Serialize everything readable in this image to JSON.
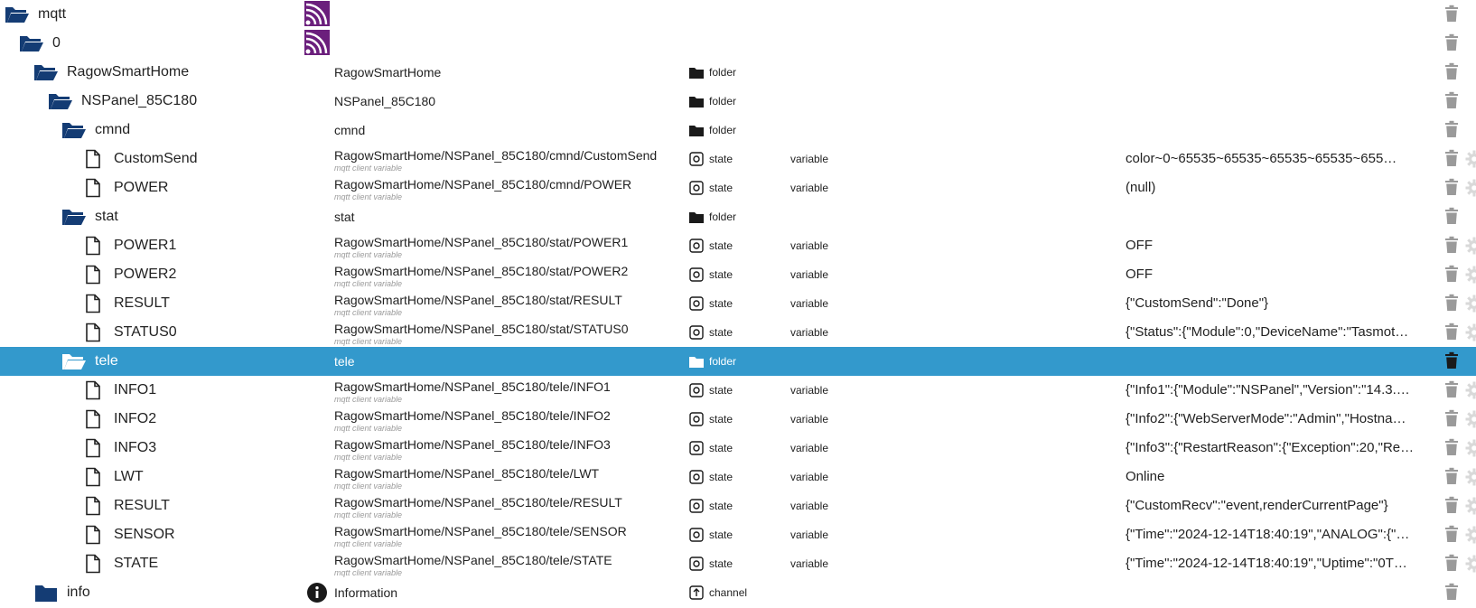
{
  "colors": {
    "folder": "#143c74",
    "selected": "#3399cc",
    "trash": "#9a9a9a",
    "adapter": "#6b1f7c"
  },
  "rows": [
    {
      "name": "mqtt",
      "icon": "folder-open",
      "depth": 0,
      "adapter": true,
      "label": "",
      "sublabel": "",
      "type": "",
      "role": "",
      "value": "",
      "gear": false
    },
    {
      "name": "0",
      "icon": "folder-open",
      "depth": 1,
      "adapter": true,
      "label": "",
      "sublabel": "",
      "type": "",
      "role": "",
      "value": "",
      "gear": false
    },
    {
      "name": "RagowSmartHome",
      "icon": "folder-open",
      "depth": 2,
      "label": "RagowSmartHome",
      "sublabel": "",
      "type": "folder",
      "role": "",
      "value": "",
      "gear": false
    },
    {
      "name": "NSPanel_85C180",
      "icon": "folder-open",
      "depth": 3,
      "label": "NSPanel_85C180",
      "sublabel": "",
      "type": "folder",
      "role": "",
      "value": "",
      "gear": false
    },
    {
      "name": "cmnd",
      "icon": "folder-open",
      "depth": 4,
      "label": "cmnd",
      "sublabel": "",
      "type": "folder",
      "role": "",
      "value": "",
      "gear": false
    },
    {
      "name": "CustomSend",
      "icon": "file",
      "depth": 5,
      "label": "RagowSmartHome/NSPanel_85C180/cmnd/CustomSend",
      "sublabel": "mqtt client variable",
      "type": "state",
      "role": "variable",
      "value": "color~0~65535~65535~65535~65535~655…",
      "gear": true
    },
    {
      "name": "POWER",
      "icon": "file",
      "depth": 5,
      "label": "RagowSmartHome/NSPanel_85C180/cmnd/POWER",
      "sublabel": "mqtt client variable",
      "type": "state",
      "role": "variable",
      "value": "(null)",
      "gear": true
    },
    {
      "name": "stat",
      "icon": "folder-open",
      "depth": 4,
      "label": "stat",
      "sublabel": "",
      "type": "folder",
      "role": "",
      "value": "",
      "gear": false
    },
    {
      "name": "POWER1",
      "icon": "file",
      "depth": 5,
      "label": "RagowSmartHome/NSPanel_85C180/stat/POWER1",
      "sublabel": "mqtt client variable",
      "type": "state",
      "role": "variable",
      "value": "OFF",
      "gear": true
    },
    {
      "name": "POWER2",
      "icon": "file",
      "depth": 5,
      "label": "RagowSmartHome/NSPanel_85C180/stat/POWER2",
      "sublabel": "mqtt client variable",
      "type": "state",
      "role": "variable",
      "value": "OFF",
      "gear": true
    },
    {
      "name": "RESULT",
      "icon": "file",
      "depth": 5,
      "label": "RagowSmartHome/NSPanel_85C180/stat/RESULT",
      "sublabel": "mqtt client variable",
      "type": "state",
      "role": "variable",
      "value": "{\"CustomSend\":\"Done\"}",
      "gear": true
    },
    {
      "name": "STATUS0",
      "icon": "file",
      "depth": 5,
      "label": "RagowSmartHome/NSPanel_85C180/stat/STATUS0",
      "sublabel": "mqtt client variable",
      "type": "state",
      "role": "variable",
      "value": "{\"Status\":{\"Module\":0,\"DeviceName\":\"Tasmot…",
      "gear": true
    },
    {
      "name": "tele",
      "icon": "folder-open",
      "depth": 4,
      "selected": true,
      "label": "tele",
      "sublabel": "",
      "type": "folder",
      "role": "",
      "value": "",
      "gear": false
    },
    {
      "name": "INFO1",
      "icon": "file",
      "depth": 5,
      "label": "RagowSmartHome/NSPanel_85C180/tele/INFO1",
      "sublabel": "mqtt client variable",
      "type": "state",
      "role": "variable",
      "value": "{\"Info1\":{\"Module\":\"NSPanel\",\"Version\":\"14.3.…",
      "gear": true
    },
    {
      "name": "INFO2",
      "icon": "file",
      "depth": 5,
      "label": "RagowSmartHome/NSPanel_85C180/tele/INFO2",
      "sublabel": "mqtt client variable",
      "type": "state",
      "role": "variable",
      "value": "{\"Info2\":{\"WebServerMode\":\"Admin\",\"Hostna…",
      "gear": true
    },
    {
      "name": "INFO3",
      "icon": "file",
      "depth": 5,
      "label": "RagowSmartHome/NSPanel_85C180/tele/INFO3",
      "sublabel": "mqtt client variable",
      "type": "state",
      "role": "variable",
      "value": "{\"Info3\":{\"RestartReason\":{\"Exception\":20,\"Re…",
      "gear": true
    },
    {
      "name": "LWT",
      "icon": "file",
      "depth": 5,
      "label": "RagowSmartHome/NSPanel_85C180/tele/LWT",
      "sublabel": "mqtt client variable",
      "type": "state",
      "role": "variable",
      "value": "Online",
      "gear": true
    },
    {
      "name": "RESULT",
      "icon": "file",
      "depth": 5,
      "label": "RagowSmartHome/NSPanel_85C180/tele/RESULT",
      "sublabel": "mqtt client variable",
      "type": "state",
      "role": "variable",
      "value": "{\"CustomRecv\":\"event,renderCurrentPage\"}",
      "gear": true
    },
    {
      "name": "SENSOR",
      "icon": "file",
      "depth": 5,
      "label": "RagowSmartHome/NSPanel_85C180/tele/SENSOR",
      "sublabel": "mqtt client variable",
      "type": "state",
      "role": "variable",
      "value": "{\"Time\":\"2024-12-14T18:40:19\",\"ANALOG\":{\"…",
      "gear": true
    },
    {
      "name": "STATE",
      "icon": "file",
      "depth": 5,
      "label": "RagowSmartHome/NSPanel_85C180/tele/STATE",
      "sublabel": "mqtt client variable",
      "type": "state",
      "role": "variable",
      "value": "{\"Time\":\"2024-12-14T18:40:19\",\"Uptime\":\"0T…",
      "gear": true
    },
    {
      "name": "info",
      "icon": "folder-closed",
      "depth": 2,
      "infoIcon": true,
      "label": "Information",
      "sublabel": "",
      "type": "channel",
      "role": "",
      "value": "",
      "gear": false
    }
  ]
}
